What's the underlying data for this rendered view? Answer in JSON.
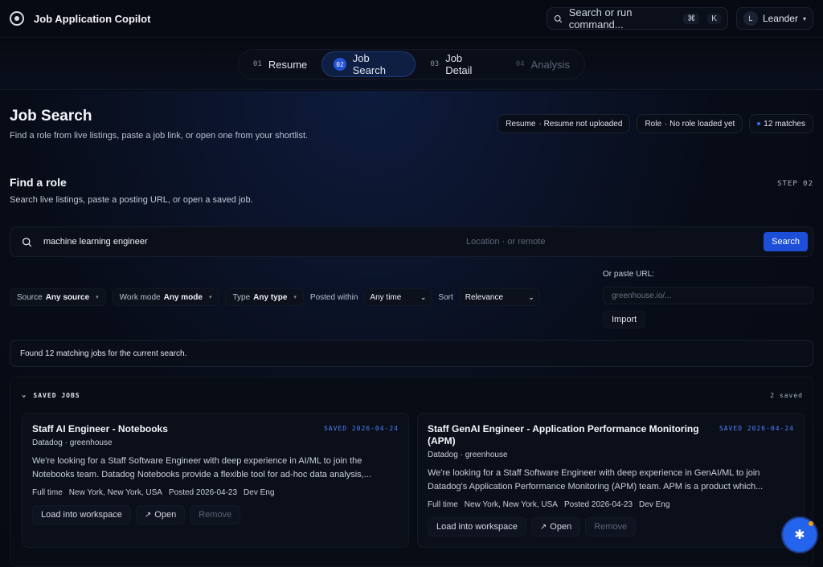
{
  "app": {
    "title": "Job Application Copilot"
  },
  "command": {
    "placeholder": "Search or run command...",
    "kbd1": "⌘",
    "kbd2": "K"
  },
  "user": {
    "initial": "L",
    "name": "Leander"
  },
  "stepper": [
    {
      "num": "01",
      "label": "Resume"
    },
    {
      "num": "02",
      "label": "Job Search"
    },
    {
      "num": "03",
      "label": "Job Detail"
    },
    {
      "num": "04",
      "label": "Analysis"
    }
  ],
  "header": {
    "title": "Job Search",
    "subtitle": "Find a role from live listings, paste a job link, or open one from your shortlist.",
    "chips": {
      "resume_key": "Resume",
      "resume_val": "· Resume not uploaded",
      "role_key": "Role",
      "role_val": "· No role loaded yet",
      "matches": "12 matches"
    }
  },
  "find": {
    "title": "Find a role",
    "subtitle": "Search live listings, paste a posting URL, or open a saved job.",
    "step": "STEP 02"
  },
  "search": {
    "query": "machine learning engineer",
    "location_placeholder": "Location · or remote",
    "button": "Search"
  },
  "filters": {
    "source_label": "Source",
    "source_value": "Any source",
    "workmode_label": "Work mode",
    "workmode_value": "Any mode",
    "type_label": "Type",
    "type_value": "Any type",
    "posted_label": "Posted within",
    "posted_value": "Any time",
    "sort_label": "Sort",
    "sort_value": "Relevance"
  },
  "paste": {
    "label": "Or paste URL:",
    "placeholder": "greenhouse.io/...",
    "button": "Import"
  },
  "found_text": "Found 12 matching jobs for the current search.",
  "saved": {
    "heading": "SAVED JOBS",
    "count": "2 saved",
    "cards": [
      {
        "title": "Staff AI Engineer - Notebooks",
        "date": "SAVED 2026-04-24",
        "company": "Datadog · greenhouse",
        "desc": "We're looking for a Staff Software Engineer with deep experience in AI/ML to join the Notebooks team. Datadog Notebooks provide a flexible tool for ad-hoc data analysis,...",
        "meta": [
          "Full time",
          "New York, New York, USA",
          "Posted 2026-04-23",
          "Dev Eng"
        ],
        "load": "Load into workspace",
        "open": "Open",
        "remove": "Remove"
      },
      {
        "title": "Staff GenAI Engineer - Application Performance Monitoring (APM)",
        "date": "SAVED 2026-04-24",
        "company": "Datadog · greenhouse",
        "desc": "We're looking for a Staff Software Engineer with deep experience in GenAI/ML to join Datadog's Application Performance Monitoring (APM) team. APM is a product which...",
        "meta": [
          "Full time",
          "New York, New York, USA",
          "Posted 2026-04-23",
          "Dev Eng"
        ],
        "load": "Load into workspace",
        "open": "Open",
        "remove": "Remove"
      }
    ]
  },
  "colors": {
    "accent": "#1d4ed8",
    "saved_date": "#4f82ff"
  }
}
